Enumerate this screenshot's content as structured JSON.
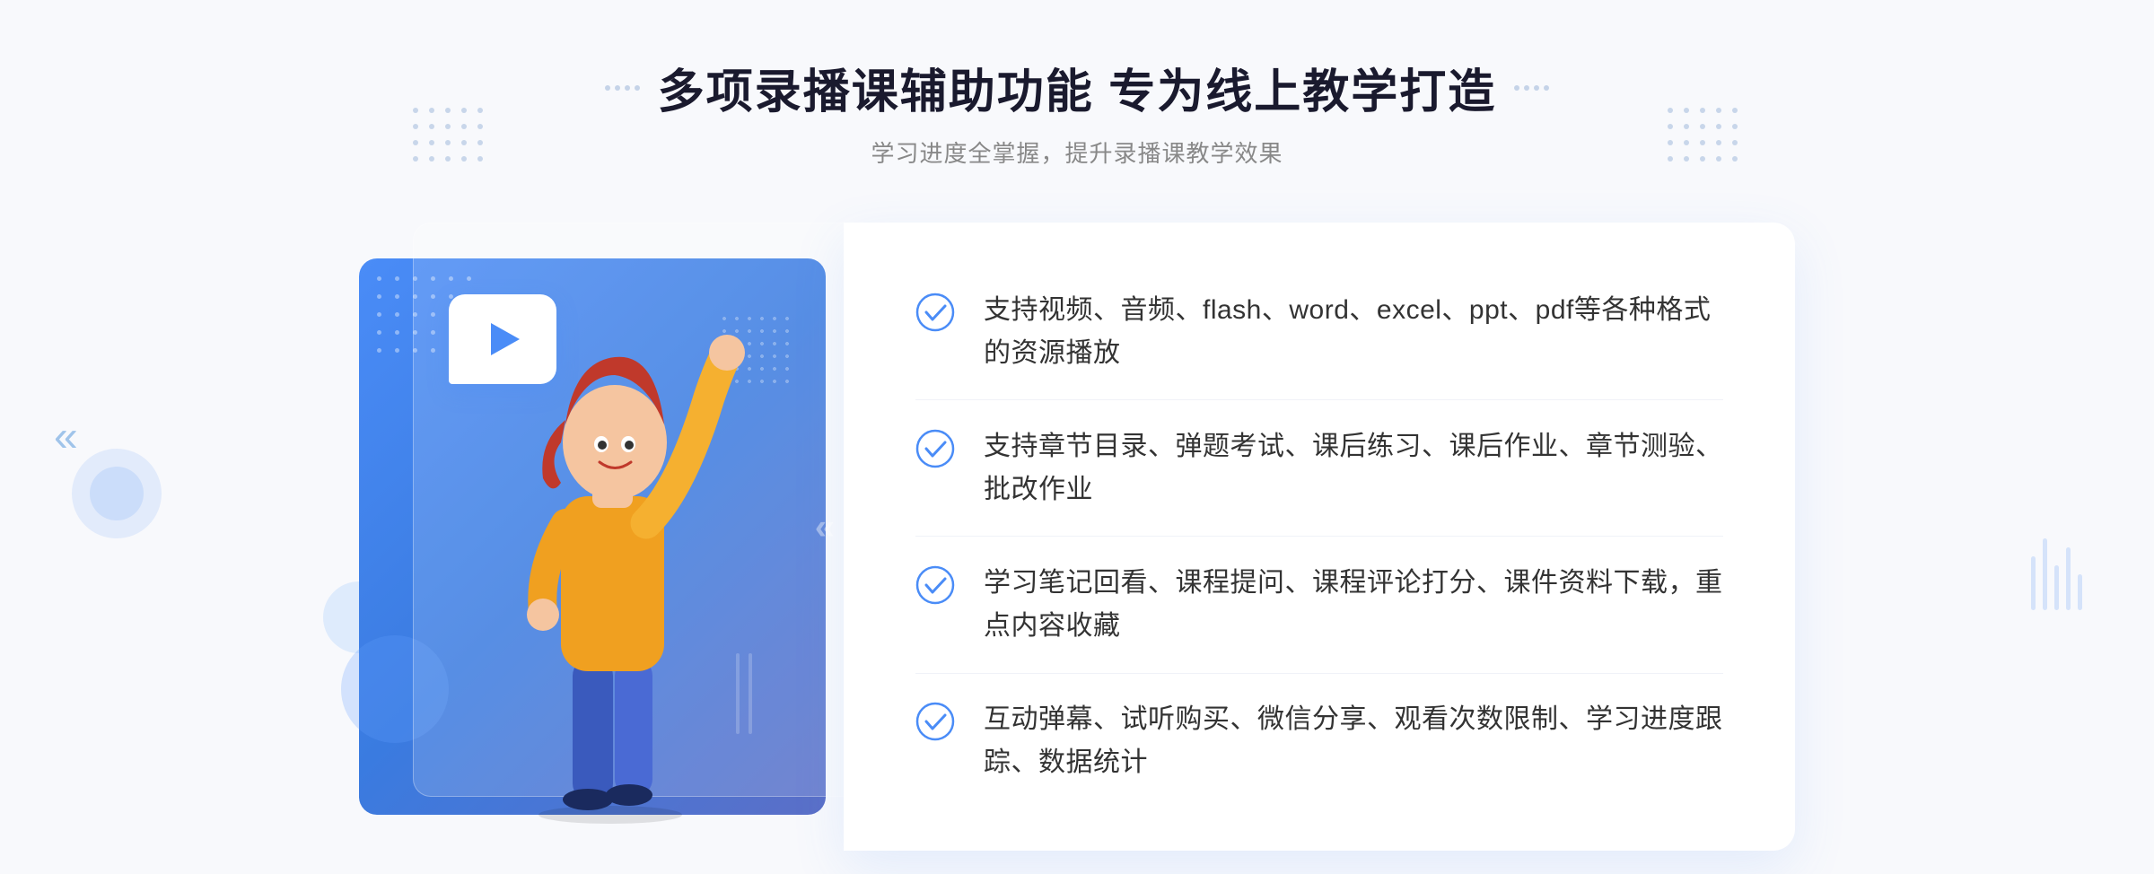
{
  "page": {
    "background": "#f8f9fc"
  },
  "header": {
    "main_title": "多项录播课辅助功能 专为线上教学打造",
    "sub_title": "学习进度全掌握，提升录播课教学效果"
  },
  "features": [
    {
      "id": "feature-1",
      "text": "支持视频、音频、flash、word、excel、ppt、pdf等各种格式的资源播放"
    },
    {
      "id": "feature-2",
      "text": "支持章节目录、弹题考试、课后练习、课后作业、章节测验、批改作业"
    },
    {
      "id": "feature-3",
      "text": "学习笔记回看、课程提问、课程评论打分、课件资料下载，重点内容收藏"
    },
    {
      "id": "feature-4",
      "text": "互动弹幕、试听购买、微信分享、观看次数限制、学习进度跟踪、数据统计"
    }
  ],
  "icons": {
    "check": "✓",
    "play": "▶",
    "chevron_left": "«",
    "chevron_right": "»"
  },
  "colors": {
    "primary_blue": "#4a8cf7",
    "dark_blue": "#3a7be0",
    "light_blue": "#e8f0fe",
    "text_dark": "#1a1a2e",
    "text_gray": "#888888",
    "text_body": "#333333",
    "white": "#ffffff",
    "check_blue": "#4a8cf7"
  }
}
